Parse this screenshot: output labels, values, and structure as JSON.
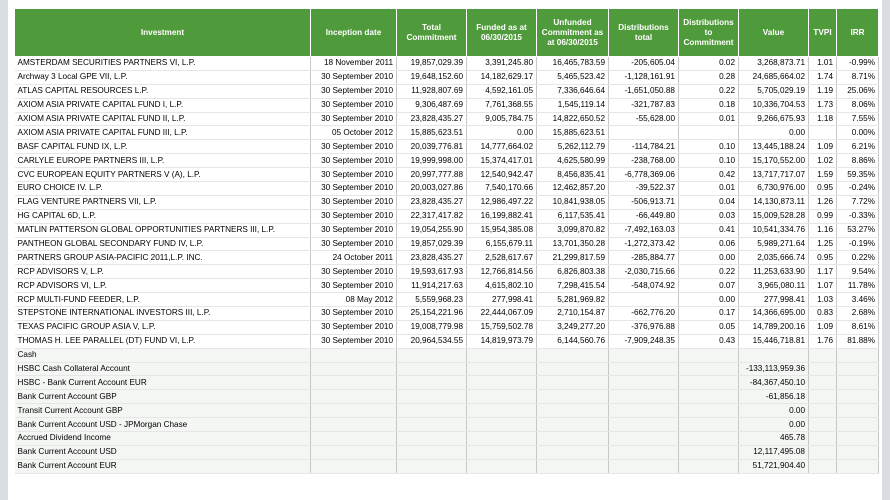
{
  "headers": {
    "investment": "Investment",
    "inception": "Inception date",
    "total_commitment": "Total Commitment",
    "funded": "Funded as at 06/30/2015",
    "unfunded": "Unfunded Commitment as at 06/30/2015",
    "distributions_total": "Distributions total",
    "dist_to_commit": "Distributions to Commitment",
    "value": "Value",
    "tvpi": "TVPI",
    "irr": "IRR"
  },
  "rows": [
    {
      "name": "AMSTERDAM SECURITIES PARTNERS VI, L.P.",
      "date": "18 November 2011",
      "commit": "19,857,029.39",
      "funded": "3,391,245.80",
      "unfunded": "16,465,783.59",
      "dist": "-205,605.04",
      "dtc": "0.02",
      "value": "3,268,873.71",
      "tvpi": "1.01",
      "irr": "-0.99%"
    },
    {
      "name": "Archway 3 Local GPE VII, L.P.",
      "date": "30 September 2010",
      "commit": "19,648,152.60",
      "funded": "14,182,629.17",
      "unfunded": "5,465,523.42",
      "dist": "-1,128,161.91",
      "dtc": "0.28",
      "value": "24,685,664.02",
      "tvpi": "1.74",
      "irr": "8.71%"
    },
    {
      "name": "ATLAS CAPITAL RESOURCES L.P.",
      "date": "30 September 2010",
      "commit": "11,928,807.69",
      "funded": "4,592,161.05",
      "unfunded": "7,336,646.64",
      "dist": "-1,651,050.88",
      "dtc": "0.22",
      "value": "5,705,029.19",
      "tvpi": "1.19",
      "irr": "25.06%"
    },
    {
      "name": "AXIOM ASIA PRIVATE CAPITAL FUND I, L.P.",
      "date": "30 September 2010",
      "commit": "9,306,487.69",
      "funded": "7,761,368.55",
      "unfunded": "1,545,119.14",
      "dist": "-321,787.83",
      "dtc": "0.18",
      "value": "10,336,704.53",
      "tvpi": "1.73",
      "irr": "8.06%"
    },
    {
      "name": "AXIOM ASIA PRIVATE CAPITAL FUND II, L.P.",
      "date": "30 September 2010",
      "commit": "23,828,435.27",
      "funded": "9,005,784.75",
      "unfunded": "14,822,650.52",
      "dist": "-55,628.00",
      "dtc": "0.01",
      "value": "9,266,675.93",
      "tvpi": "1.18",
      "irr": "7.55%"
    },
    {
      "name": "AXIOM ASIA PRIVATE CAPITAL FUND III, L.P.",
      "date": "05 October 2012",
      "commit": "15,885,623.51",
      "funded": "0.00",
      "unfunded": "15,885,623.51",
      "dist": "",
      "dtc": "",
      "value": "0.00",
      "tvpi": "",
      "irr": "0.00%"
    },
    {
      "name": "BASF CAPITAL FUND IX, L.P.",
      "date": "30 September 2010",
      "commit": "20,039,776.81",
      "funded": "14,777,664.02",
      "unfunded": "5,262,112.79",
      "dist": "-114,784.21",
      "dtc": "0.10",
      "value": "13,445,188.24",
      "tvpi": "1.09",
      "irr": "6.21%"
    },
    {
      "name": "CARLYLE EUROPE PARTNERS III, L.P.",
      "date": "30 September 2010",
      "commit": "19,999,998.00",
      "funded": "15,374,417.01",
      "unfunded": "4,625,580.99",
      "dist": "-238,768.00",
      "dtc": "0.10",
      "value": "15,170,552.00",
      "tvpi": "1.02",
      "irr": "8.86%"
    },
    {
      "name": "CVC EUROPEAN EQUITY PARTNERS V (A), L.P.",
      "date": "30 September 2010",
      "commit": "20,997,777.88",
      "funded": "12,540,942.47",
      "unfunded": "8,456,835.41",
      "dist": "-6,778,369.06",
      "dtc": "0.42",
      "value": "13,717,717.07",
      "tvpi": "1.59",
      "irr": "59.35%"
    },
    {
      "name": "EURO CHOICE IV. L.P.",
      "date": "30 September 2010",
      "commit": "20,003,027.86",
      "funded": "7,540,170.66",
      "unfunded": "12,462,857.20",
      "dist": "-39,522.37",
      "dtc": "0.01",
      "value": "6,730,976.00",
      "tvpi": "0.95",
      "irr": "-0.24%"
    },
    {
      "name": "FLAG VENTURE PARTNERS VII, L.P.",
      "date": "30 September 2010",
      "commit": "23,828,435.27",
      "funded": "12,986,497.22",
      "unfunded": "10,841,938.05",
      "dist": "-506,913.71",
      "dtc": "0.04",
      "value": "14,130,873.11",
      "tvpi": "1.26",
      "irr": "7.72%"
    },
    {
      "name": "HG CAPITAL 6D, L.P.",
      "date": "30 September 2010",
      "commit": "22,317,417.82",
      "funded": "16,199,882.41",
      "unfunded": "6,117,535.41",
      "dist": "-66,449.80",
      "dtc": "0.03",
      "value": "15,009,528.28",
      "tvpi": "0.99",
      "irr": "-0.33%"
    },
    {
      "name": "MATLIN PATTERSON GLOBAL OPPORTUNITIES PARTNERS III, L.P.",
      "date": "30 September 2010",
      "commit": "19,054,255.90",
      "funded": "15,954,385.08",
      "unfunded": "3,099,870.82",
      "dist": "-7,492,163.03",
      "dtc": "0.41",
      "value": "10,541,334.76",
      "tvpi": "1.16",
      "irr": "53.27%"
    },
    {
      "name": "PANTHEON GLOBAL SECONDARY FUND IV, L.P.",
      "date": "30 September 2010",
      "commit": "19,857,029.39",
      "funded": "6,155,679.11",
      "unfunded": "13,701,350.28",
      "dist": "-1,272,373.42",
      "dtc": "0.06",
      "value": "5,989,271.64",
      "tvpi": "1.25",
      "irr": "-0.19%"
    },
    {
      "name": "PARTNERS GROUP ASIA-PACIFIC 2011,L.P. INC.",
      "date": "24 October 2011",
      "commit": "23,828,435.27",
      "funded": "2,528,617.67",
      "unfunded": "21,299,817.59",
      "dist": "-285,884.77",
      "dtc": "0.00",
      "value": "2,035,666.74",
      "tvpi": "0.95",
      "irr": "0.22%"
    },
    {
      "name": "RCP ADVISORS V, L.P.",
      "date": "30 September 2010",
      "commit": "19,593,617.93",
      "funded": "12,766,814.56",
      "unfunded": "6,826,803.38",
      "dist": "-2,030,715.66",
      "dtc": "0.22",
      "value": "11,253,633.90",
      "tvpi": "1.17",
      "irr": "9.54%"
    },
    {
      "name": "RCP ADVISORS VI, L.P.",
      "date": "30 September 2010",
      "commit": "11,914,217.63",
      "funded": "4,615,802.10",
      "unfunded": "7,298,415.54",
      "dist": "-548,074.92",
      "dtc": "0.07",
      "value": "3,965,080.11",
      "tvpi": "1.07",
      "irr": "11.78%"
    },
    {
      "name": "RCP MULTI-FUND FEEDER, L.P.",
      "date": "08 May 2012",
      "commit": "5,559,968.23",
      "funded": "277,998.41",
      "unfunded": "5,281,969.82",
      "dist": "",
      "dtc": "0.00",
      "value": "277,998.41",
      "tvpi": "1.03",
      "irr": "3.46%"
    },
    {
      "name": "STEPSTONE INTERNATIONAL INVESTORS III, L.P.",
      "date": "30 September 2010",
      "commit": "25,154,221.96",
      "funded": "22,444,067.09",
      "unfunded": "2,710,154.87",
      "dist": "-662,776.20",
      "dtc": "0.17",
      "value": "14,366,695.00",
      "tvpi": "0.83",
      "irr": "2.68%"
    },
    {
      "name": "TEXAS PACIFIC GROUP ASIA V, L.P.",
      "date": "30 September 2010",
      "commit": "19,008,779.98",
      "funded": "15,759,502.78",
      "unfunded": "3,249,277.20",
      "dist": "-376,976.88",
      "dtc": "0.05",
      "value": "14,789,200.16",
      "tvpi": "1.09",
      "irr": "8.61%"
    },
    {
      "name": "THOMAS H. LEE PARALLEL (DT) FUND VI, L.P.",
      "date": "30 September 2010",
      "commit": "20,964,534.55",
      "funded": "14,819,973.79",
      "unfunded": "6,144,560.76",
      "dist": "-7,909,248.35",
      "dtc": "0.43",
      "value": "15,446,718.81",
      "tvpi": "1.76",
      "irr": "81.88%"
    }
  ],
  "cash_section": {
    "label": "Cash",
    "rows": [
      {
        "name": "HSBC Cash Collateral Account",
        "value": "-133,113,959.36"
      },
      {
        "name": "HSBC - Bank Current Account EUR",
        "value": "-84,367,450.10"
      },
      {
        "name": "Bank Current Account GBP",
        "value": "-61,856.18"
      },
      {
        "name": "Transit Current Account GBP",
        "value": "0.00"
      },
      {
        "name": "Bank Current Account USD - JPMorgan Chase",
        "value": "0.00"
      },
      {
        "name": "Accrued Dividend Income",
        "value": "465.78"
      },
      {
        "name": "Bank Current Account USD",
        "value": "12,117,495.08"
      },
      {
        "name": "Bank Current Account EUR",
        "value": "51,721,904.40"
      }
    ]
  }
}
